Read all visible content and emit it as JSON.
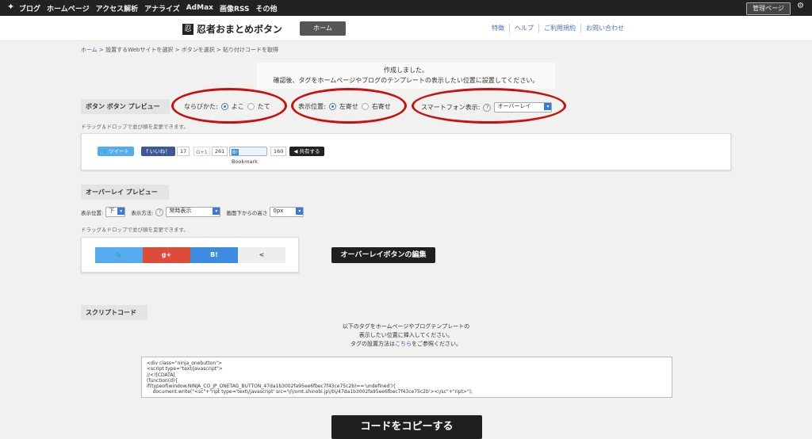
{
  "topbar": {
    "brand_icon": "shuriken-icon",
    "nav": [
      "ブログ",
      "ホームページ",
      "アクセス解析",
      "アナライズ",
      "AdMax",
      "画像RSS",
      "その他"
    ],
    "admin_label": "管理ページ",
    "settings_icon": "gear-icon"
  },
  "header": {
    "logo_text": "忍者おまとめボタン",
    "home_tab": "ホーム",
    "links": [
      "特徴",
      "ヘルプ",
      "ご利用規約",
      "お問い合わせ"
    ]
  },
  "breadcrumb": {
    "home": "ホーム",
    "rest": " > 設置するWebサイトを選択 > ボタンを選択 > 貼り付けコードを取得"
  },
  "notice": {
    "line1": "作成しました。",
    "line2": "確認後、タグをホームページやブログのテンプレートの表示したい位置に設置してください。"
  },
  "button_preview": {
    "tab_label": "ボタン ボタン プレビュー",
    "arrange_label": "ならびかた:",
    "arrange_options": [
      "よこ",
      "たて"
    ],
    "arrange_selected": "よこ",
    "position_label": "表示位置:",
    "position_options": [
      "左寄せ",
      "右寄せ"
    ],
    "position_selected": "左寄せ",
    "smartphone_label": "スマートフォン表示:",
    "smartphone_value": "オーバーレイ",
    "drag_hint": "ドラッグ＆ドロップで並び順を変更できます。",
    "buttons": {
      "tweet": "ツイート",
      "like": "いいね！",
      "like_count": "17",
      "gplus": "G+1",
      "gplus_count": "261",
      "bookmark": "Bookmark",
      "bookmark_count": "160",
      "share": "共有する"
    }
  },
  "overlay_preview": {
    "tab_label": "オーバーレイ プレビュー",
    "position_label": "表示位置:",
    "position_value": "下",
    "method_label": "表示方法:",
    "method_value": "常時表示",
    "height_label": "画面下からの高さ",
    "height_value": "0px",
    "drag_hint": "ドラッグ＆ドロップで並び順を変更できます。",
    "buttons": [
      "twitter-icon",
      "google-plus-icon",
      "hatena-bookmark-icon",
      "share-icon"
    ],
    "gplus_glyph": "g+",
    "hatena_glyph": "B!",
    "twitter_glyph": "🐦",
    "share_glyph": "<",
    "edit_button": "オーバーレイボタンの編集"
  },
  "script_code": {
    "tab_label": "スクリプトコード",
    "desc_line1": "以下のタグをホームページやブログテンプレートの",
    "desc_line2": "表示したい位置に挿入してください。",
    "desc_line3_pre": "タグの設置方法は",
    "desc_line3_link": "こちら",
    "desc_line3_post": "をご参照ください。",
    "code": "<div class=\"ninja_onebutton\">\n<script type=\"text/javascript\">\n//<![CDATA[\n(function(d){\nif(typeof(window.NINJA_CO_JP_ONETAG_BUTTON_47da1b3002fa95ee6fbec7f43ce75c2b)=='undefined'){\n    document.write(\"<sc\"+\"ript type='text\\/javascript' src='\\/\\/omt.shinobi.jp\\/b\\/47da1b3002fa95ee6fbec7f43ce75c2b'><\\/sc\"+\"ript>\");",
    "copy_button": "コードをコピーする"
  },
  "colors": {
    "annotation_circle": "#c81010",
    "twitter": "#55acee",
    "gplus": "#dd4b39",
    "hatena": "#3c8be0",
    "share": "#eeeeee",
    "radio_selected": "#3a7bd5"
  }
}
